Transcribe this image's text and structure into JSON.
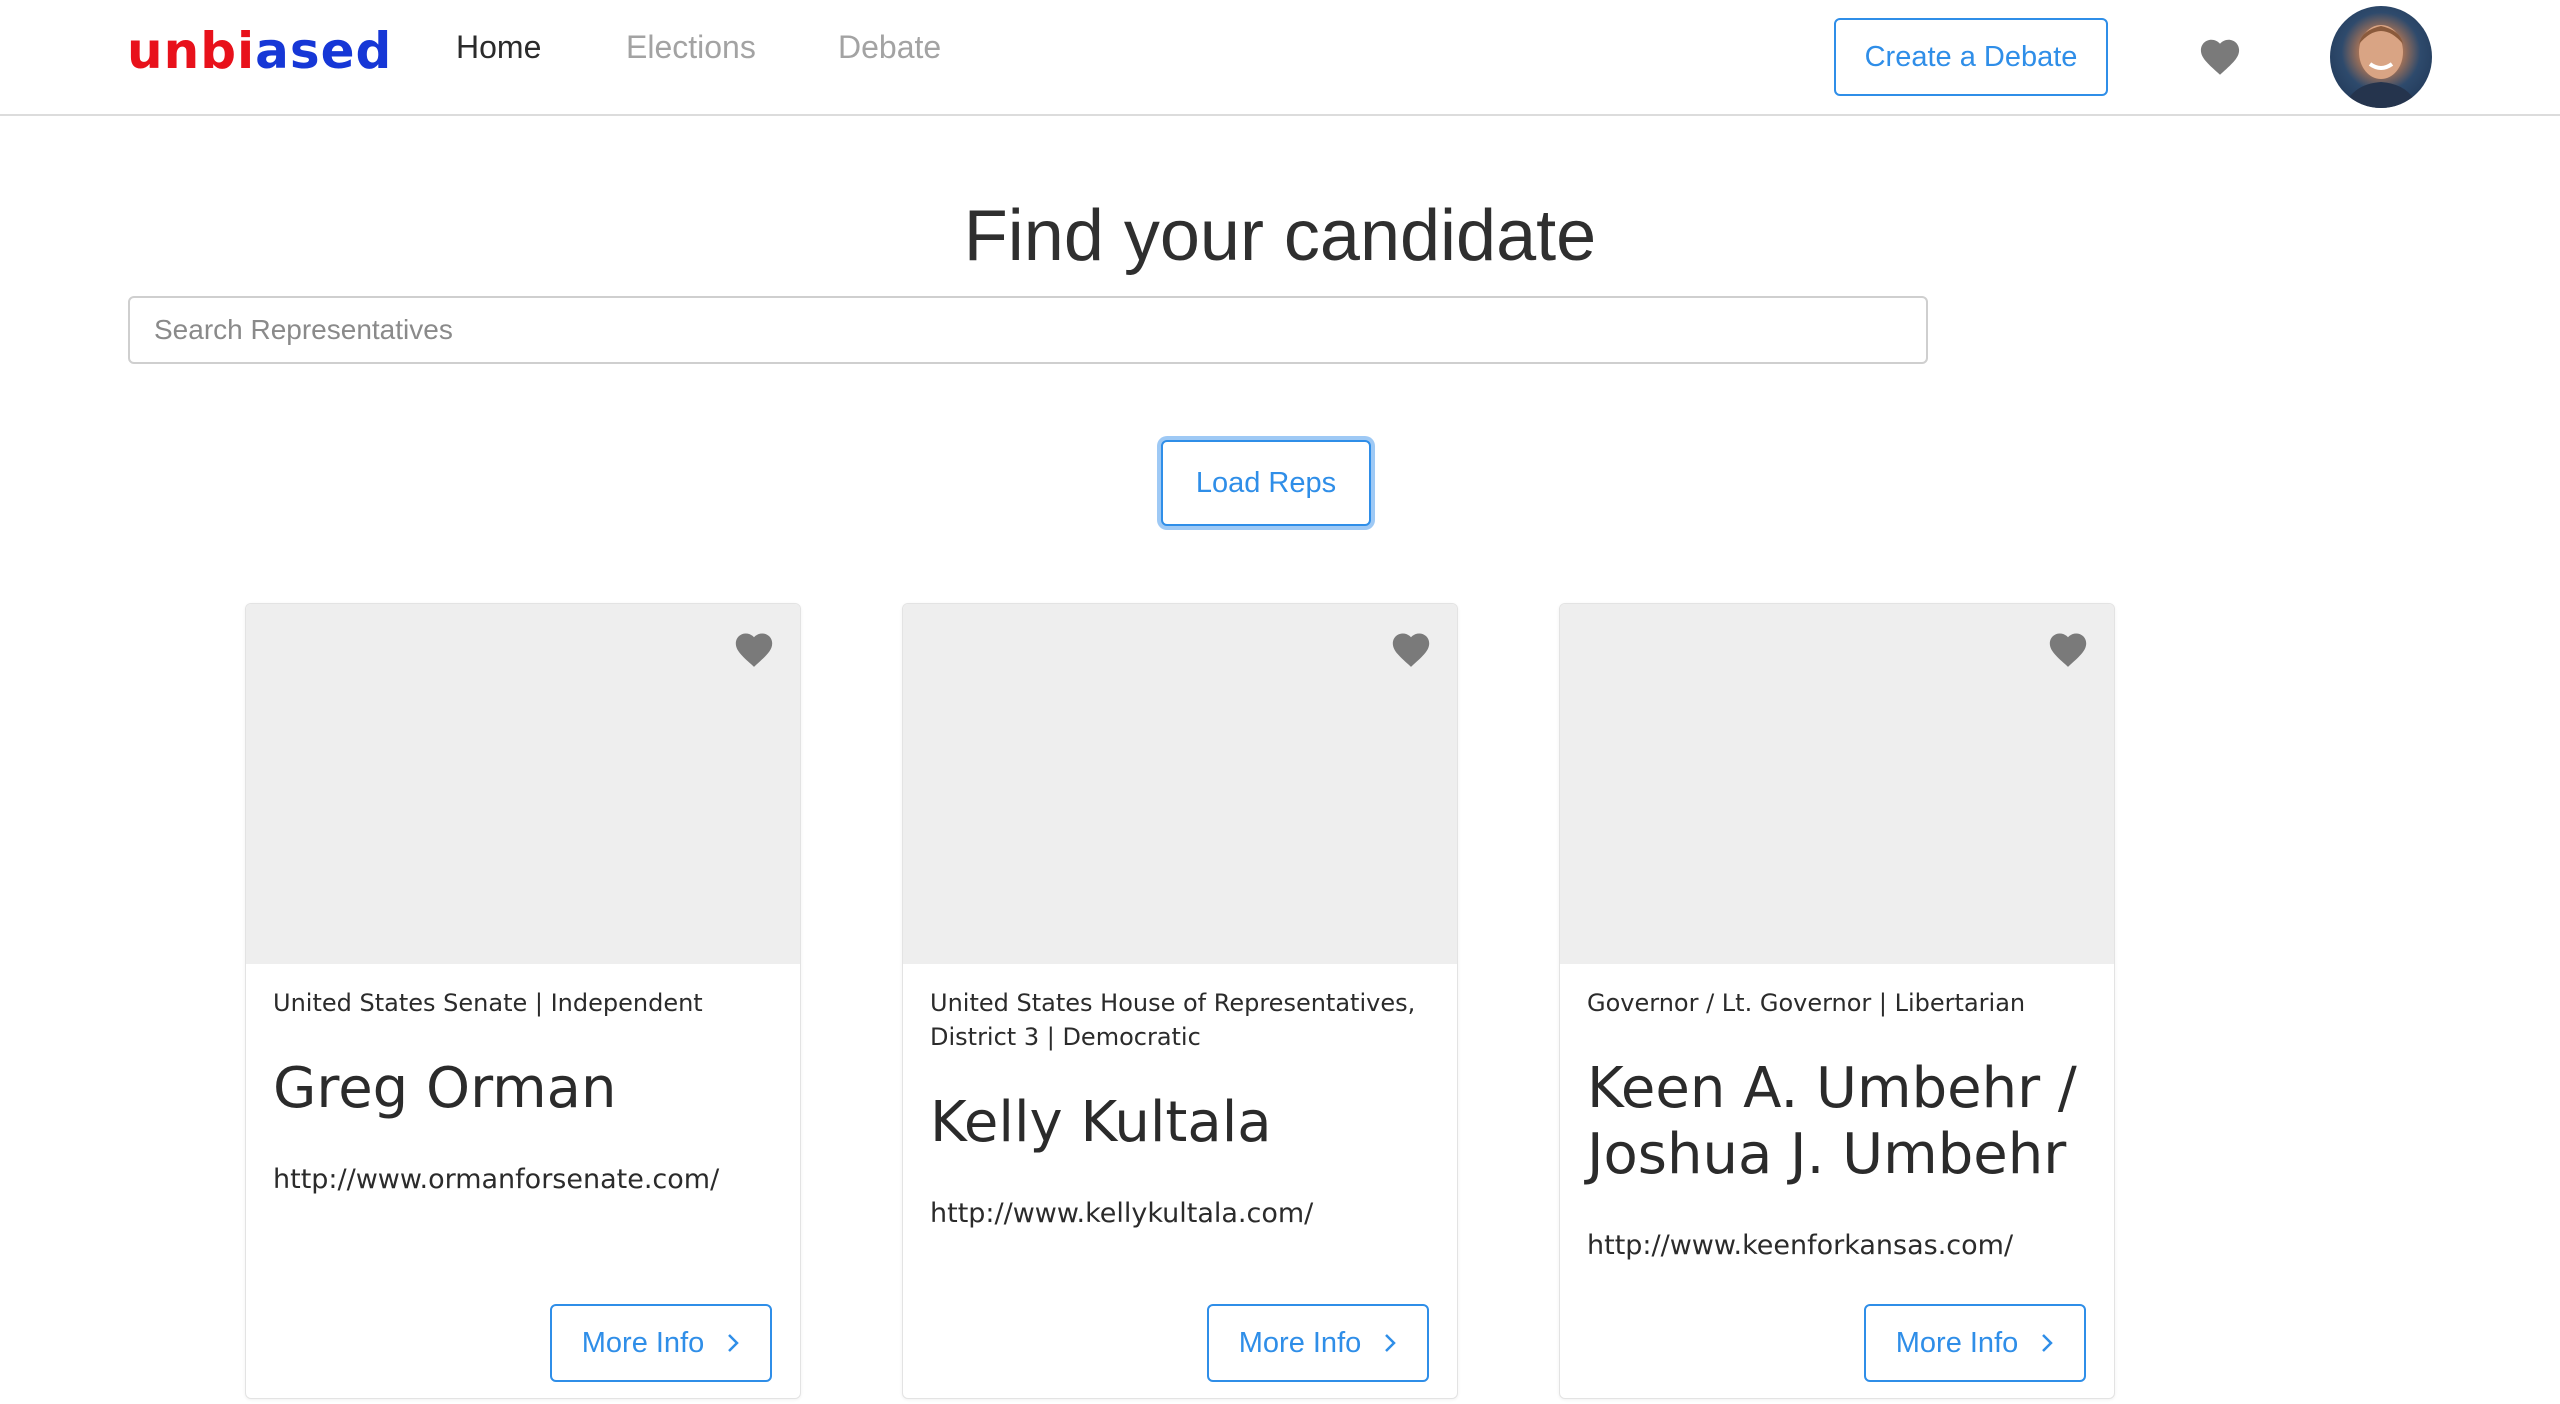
{
  "nav": {
    "logo_part1": "unbi",
    "logo_part2": "ased",
    "links": [
      {
        "label": "Home",
        "active": true
      },
      {
        "label": "Elections",
        "active": false
      },
      {
        "label": "Debate",
        "active": false
      }
    ],
    "create_debate_label": "Create a Debate",
    "favorites_icon": "heart-icon",
    "avatar_icon": "user-avatar"
  },
  "main": {
    "title": "Find your candidate",
    "search_placeholder": "Search Representatives",
    "search_value": "",
    "load_reps_label": "Load Reps"
  },
  "cards": [
    {
      "office": "United States Senate | Independent",
      "name": "Greg Orman",
      "url": "http://www.ormanforsenate.com/",
      "more_info_label": "More Info"
    },
    {
      "office": "United States House of Representatives, District 3 | Democratic",
      "name": "Kelly Kultala",
      "url": "http://www.kellykultala.com/",
      "more_info_label": "More Info"
    },
    {
      "office": "Governor / Lt. Governor | Libertarian",
      "name": "Keen A. Umbehr / Joshua J. Umbehr",
      "url": "http://www.keenforkansas.com/",
      "more_info_label": "More Info"
    }
  ],
  "colors": {
    "accent": "#2f8ee8",
    "logo_red": "#e8111b",
    "logo_blue": "#1637d6",
    "icon_gray": "#7a7a7a",
    "card_image_bg": "#eeeeee"
  }
}
